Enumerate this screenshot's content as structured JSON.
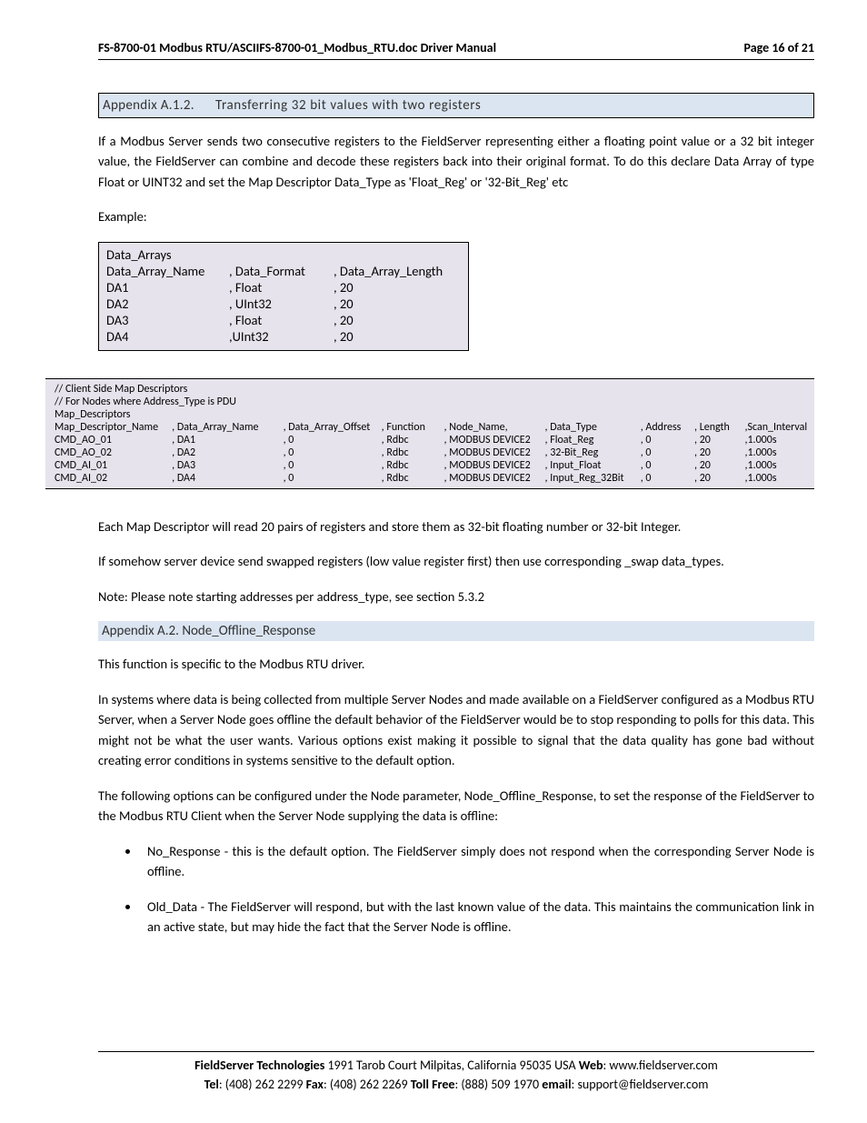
{
  "header": {
    "left": "FS-8700-01 Modbus RTU/ASCIIFS-8700-01_Modbus_RTU.doc Driver Manual",
    "right": "Page 16 of 21"
  },
  "sectionA12": {
    "num": "Appendix A.1.2.",
    "title": "Transferring 32 bit values with two registers"
  },
  "paraA12_1": "If a Modbus Server sends two consecutive registers to the FieldServer representing either a floating point value or a 32 bit integer value, the FieldServer can combine and decode these registers back into their original format. To do this declare Data Array of type Float or UINT32 and set the Map Descriptor Data_Type  as 'Float_Reg' or '32-Bit_Reg' etc",
  "exampleLabel": "Example:",
  "t1": {
    "title": "Data_Arrays",
    "h1": "Data_Array_Name",
    "h2": ", Data_Format",
    "h3": ", Data_Array_Length",
    "rows": [
      {
        "c1": "DA1",
        "c2": ", Float",
        "c3": ", 20"
      },
      {
        "c1": "DA2",
        "c2": ", UInt32",
        "c3": ", 20"
      },
      {
        "c1": "DA3",
        "c2": ", Float",
        "c3": ", 20"
      },
      {
        "c1": "DA4",
        "c2": ",UInt32",
        "c3": ", 20"
      }
    ]
  },
  "t2": {
    "l1": "//   Client Side Map Descriptors",
    "l2": "// For Nodes where Address_Type is PDU",
    "l3": "Map_Descriptors",
    "h": [
      "Map_Descriptor_Name",
      ", Data_Array_Name",
      ", Data_Array_Offset",
      ", Function",
      ", Node_Name,",
      ", Data_Type",
      ", Address",
      ", Length",
      ",Scan_Interval"
    ],
    "rows": [
      [
        "CMD_AO_01",
        ", DA1",
        ", 0",
        ", Rdbc",
        ", MODBUS DEVICE2",
        ", Float_Reg",
        ", 0",
        ", 20",
        ",1.000s"
      ],
      [
        "CMD_AO_02",
        ", DA2",
        ", 0",
        ", Rdbc",
        ", MODBUS DEVICE2",
        ", 32-Bit_Reg",
        ", 0",
        ", 20",
        ",1.000s"
      ],
      [
        "CMD_AI_01",
        ", DA3",
        ", 0",
        ", Rdbc",
        ", MODBUS DEVICE2",
        ", Input_Float",
        ", 0",
        ", 20",
        ",1.000s"
      ],
      [
        "CMD_AI_02",
        ", DA4",
        ", 0",
        ", Rdbc",
        ", MODBUS DEVICE2",
        ", Input_Reg_32Bit",
        ", 0",
        ", 20",
        ",1.000s"
      ]
    ]
  },
  "paraA12_2": "Each Map Descriptor will read 20 pairs of registers and store them as 32-bit floating number or 32-bit Integer.",
  "paraA12_3": "If somehow server device send swapped registers (low value register first) then use corresponding _swap data_types.",
  "paraA12_4": "Note:  Please note starting addresses per address_type, see section 5.3.2",
  "sectionA2": {
    "title": "Appendix A.2. Node_Offline_Response"
  },
  "paraA2_1": "This function is specific to the Modbus RTU driver.",
  "paraA2_2": "In systems where data is being collected from multiple Server Nodes and made available on a FieldServer configured as a Modbus RTU Server, when a Server Node goes offline the default behavior of the FieldServer would be to stop responding to polls for this data.  This might not be what the user wants.  Various options exist making it possible to signal that the data quality has gone bad without creating error conditions in systems sensitive to the default option.",
  "paraA2_3": "The following options can be configured under the Node parameter, Node_Offline_Response, to set the response of the FieldServer to the Modbus RTU Client when the Server Node supplying the data is offline:",
  "bullets": [
    "No_Response - this is the default option. The FieldServer simply does not respond when the corresponding Server Node is offline.",
    "Old_Data - The FieldServer will respond, but with the last known value of the data. This maintains the communication link in an active state, but may hide the fact that the Server Node is offline."
  ],
  "footer": {
    "company": "FieldServer Technologies",
    "addr": " 1991 Tarob Court Milpitas, California 95035 USA   ",
    "webL": "Web",
    "web": ": www.fieldserver.com",
    "telL": "Tel",
    "tel": ": (408) 262 2299   ",
    "faxL": "Fax",
    "fax": ": (408) 262 2269   ",
    "tfL": "Toll Free",
    "tf": ": (888) 509 1970   ",
    "emL": "email",
    "em": ": support@fieldserver.com"
  }
}
